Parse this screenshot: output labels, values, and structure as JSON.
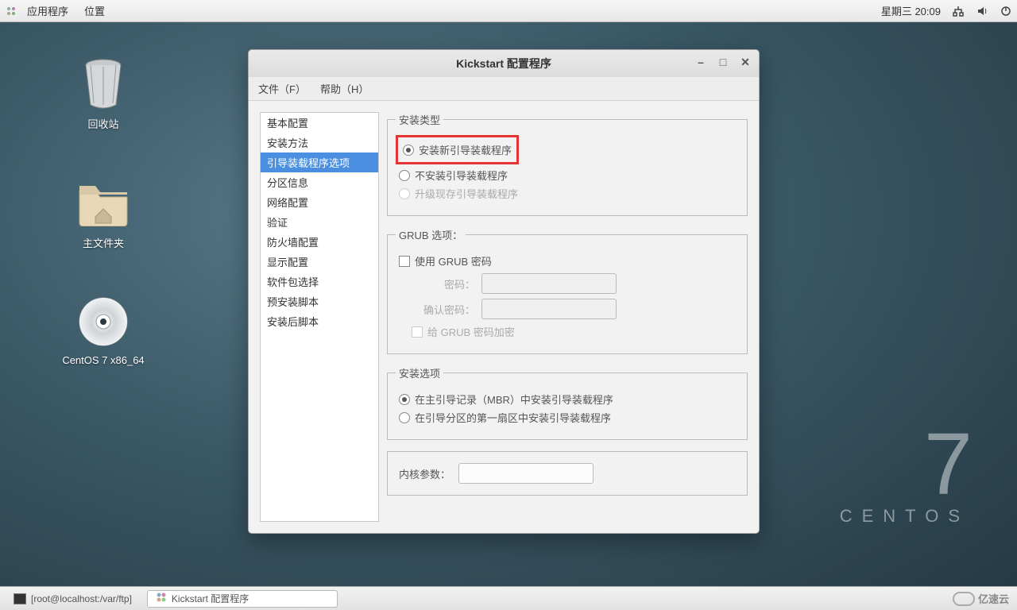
{
  "topbar": {
    "apps": "应用程序",
    "places": "位置",
    "datetime": "星期三 20:09"
  },
  "desktop": {
    "trash": "回收站",
    "home": "主文件夹",
    "disc": "CentOS 7 x86_64"
  },
  "brand": {
    "big": "7",
    "word": "CENTOS"
  },
  "window": {
    "title": "Kickstart 配置程序",
    "menu": {
      "file": "文件（F）",
      "help": "帮助（H）"
    },
    "sidebar": [
      "基本配置",
      "安装方法",
      "引导装载程序选项",
      "分区信息",
      "网络配置",
      "验证",
      "防火墙配置",
      "显示配置",
      "软件包选择",
      "预安装脚本",
      "安装后脚本"
    ],
    "sidebar_selected": 2,
    "grp_install_type": {
      "legend": "安装类型",
      "opt1": "安装新引导装载程序",
      "opt2": "不安装引导装载程序",
      "opt3": "升级现存引导装载程序"
    },
    "grp_grub": {
      "legend": "GRUB 选项：",
      "use_pw": "使用  GRUB 密码",
      "pw": "密码：",
      "pw2": "确认密码：",
      "encrypt": "给 GRUB 密码加密"
    },
    "grp_install_opts": {
      "legend": "安装选项",
      "opt1": "在主引导记录（MBR）中安装引导装载程序",
      "opt2": "在引导分区的第一扇区中安装引导装载程序"
    },
    "kernel_label": "内核参数：",
    "kernel_value": ""
  },
  "taskbar": {
    "terminal": "[root@localhost:/var/ftp]",
    "app": "Kickstart 配置程序"
  },
  "watermark": "亿速云"
}
